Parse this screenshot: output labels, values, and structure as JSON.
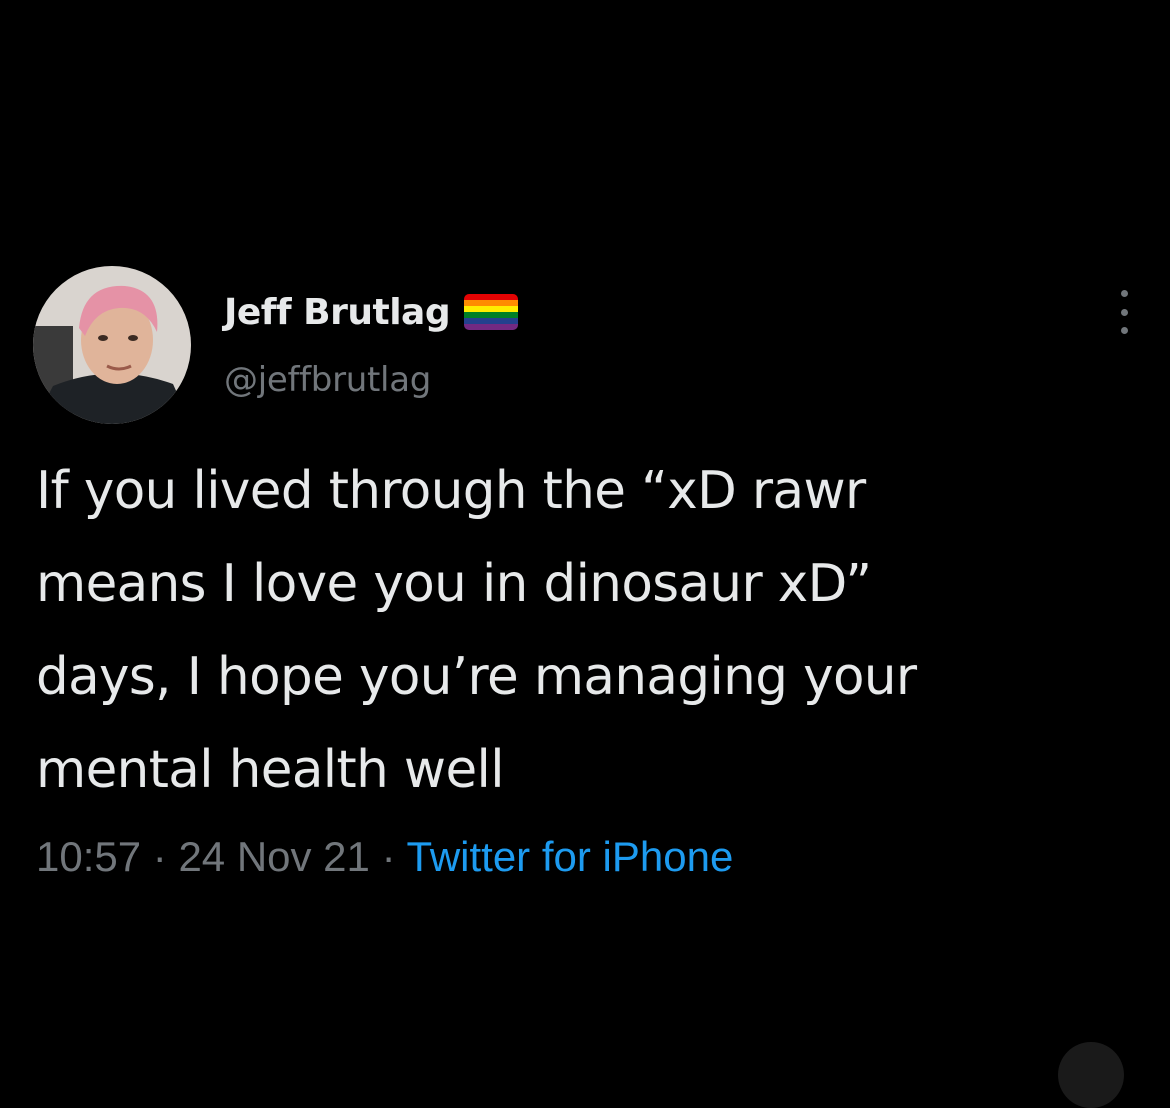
{
  "user": {
    "display_name": "Jeff Brutlag",
    "handle": "@jeffbrutlag",
    "avatar_icon": "profile-photo",
    "badge_icon": "rainbow-flag-icon",
    "flag_colors": [
      "#e40303",
      "#ff8c00",
      "#ffed00",
      "#008026",
      "#24408e",
      "#732982"
    ]
  },
  "tweet": {
    "text_lines": [
      "If you lived through the “xD rawr",
      "means I love you in dinosaur xD”",
      "days, I hope you’re managing your",
      "mental health well"
    ],
    "time": "10:57",
    "separator": " · ",
    "date": "24 Nov 21",
    "source": "Twitter for iPhone"
  },
  "colors": {
    "background": "#000000",
    "text": "#e7e9ea",
    "secondary": "#71767b",
    "link": "#1d9bf0"
  },
  "more_icon": "more-vertical-icon"
}
